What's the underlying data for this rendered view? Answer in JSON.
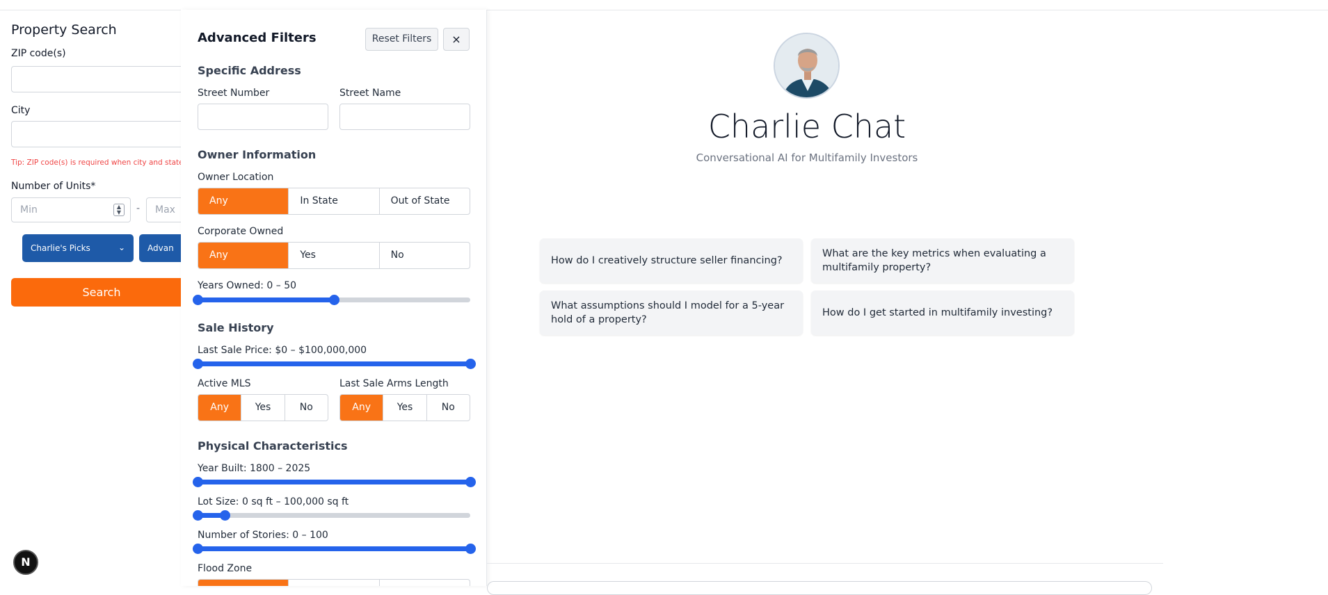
{
  "search": {
    "title": "Property Search",
    "zip_label": "ZIP code(s)",
    "city_label": "City",
    "tip": "Tip: ZIP code(s) is required when city and state",
    "units_label": "Number of Units*",
    "min_placeholder": "Min",
    "max_placeholder": "Max",
    "dash": "-",
    "charlies_picks": "Charlie's Picks",
    "advanced": "Advan",
    "search_button": "Search"
  },
  "filters": {
    "title": "Advanced Filters",
    "reset": "Reset Filters",
    "close": "×",
    "specific_address": "Specific Address",
    "street_number": "Street Number",
    "street_name": "Street Name",
    "owner_info": "Owner Information",
    "owner_location": "Owner Location",
    "owner_location_options": [
      "Any",
      "In State",
      "Out of State"
    ],
    "corporate_owned": "Corporate Owned",
    "corporate_owned_options": [
      "Any",
      "Yes",
      "No"
    ],
    "years_owned": "Years Owned: 0 – 50",
    "years_owned_range": [
      0,
      50
    ],
    "sale_history": "Sale History",
    "last_sale_price": "Last Sale Price: $0 – $100,000,000",
    "last_sale_price_range": [
      0,
      100000000
    ],
    "active_mls": "Active MLS",
    "active_mls_options": [
      "Any",
      "Yes",
      "No"
    ],
    "arms_length": "Last Sale Arms Length",
    "arms_length_options": [
      "Any",
      "Yes",
      "No"
    ],
    "physical": "Physical Characteristics",
    "year_built": "Year Built: 1800 – 2025",
    "year_built_range": [
      1800,
      2025
    ],
    "lot_size": "Lot Size: 0 sq ft – 100,000 sq ft",
    "lot_size_range": [
      0,
      100000
    ],
    "stories": "Number of Stories: 0 – 100",
    "stories_range": [
      0,
      100
    ],
    "flood_zone": "Flood Zone"
  },
  "chat": {
    "title": "Charlie Chat",
    "subtitle": "Conversational AI for Multifamily Investors",
    "suggestions": [
      "How do I creatively structure seller financing?",
      "What are the key metrics when evaluating a multifamily property?",
      "What assumptions should I model for a 5-year hold of a property?",
      "How do I get started in multifamily investing?"
    ]
  },
  "badge": "N",
  "colors": {
    "accent_orange": "#f97316",
    "slider_blue": "#2563eb",
    "button_blue": "#1e5aa8"
  }
}
